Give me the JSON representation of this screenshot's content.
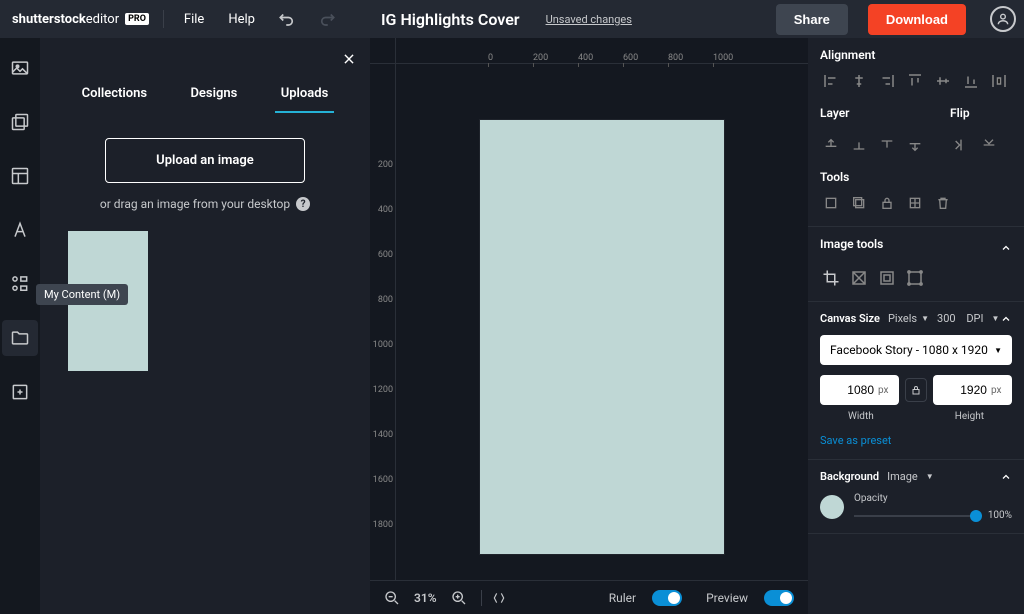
{
  "brand": {
    "main": "shutterstock",
    "sub": "editor",
    "badge": "PRO"
  },
  "menu": {
    "file": "File",
    "help": "Help"
  },
  "document": {
    "title": "IG Highlights Cover",
    "status": "Unsaved changes"
  },
  "actions": {
    "share": "Share",
    "download": "Download"
  },
  "rail_tooltip": "My Content (M)",
  "panel": {
    "tabs": [
      "Collections",
      "Designs",
      "Uploads"
    ],
    "active_tab": 2,
    "upload_btn": "Upload an image",
    "drag_hint": "or drag an image from your desktop"
  },
  "ruler_h": [
    "0",
    "200",
    "400",
    "600",
    "800",
    "1000"
  ],
  "ruler_v": [
    "200",
    "400",
    "600",
    "800",
    "1000",
    "1200",
    "1400",
    "1600",
    "1800"
  ],
  "bottombar": {
    "zoom": "31%",
    "ruler": "Ruler",
    "preview": "Preview"
  },
  "right": {
    "alignment": {
      "title": "Alignment"
    },
    "layer": {
      "title": "Layer"
    },
    "flip": {
      "title": "Flip"
    },
    "tools": {
      "title": "Tools"
    },
    "image_tools": {
      "title": "Image tools"
    },
    "canvas_size": {
      "title": "Canvas Size",
      "unit_label": "Pixels",
      "dpi_value": "300",
      "dpi_label": "DPI",
      "preset": "Facebook Story - 1080 x 1920",
      "width_value": "1080",
      "height_value": "1920",
      "px": "px",
      "width_label": "Width",
      "height_label": "Height",
      "save_preset": "Save as preset"
    },
    "background": {
      "title": "Background",
      "mode": "Image",
      "opacity_label": "Opacity",
      "opacity_value": "100%"
    }
  }
}
